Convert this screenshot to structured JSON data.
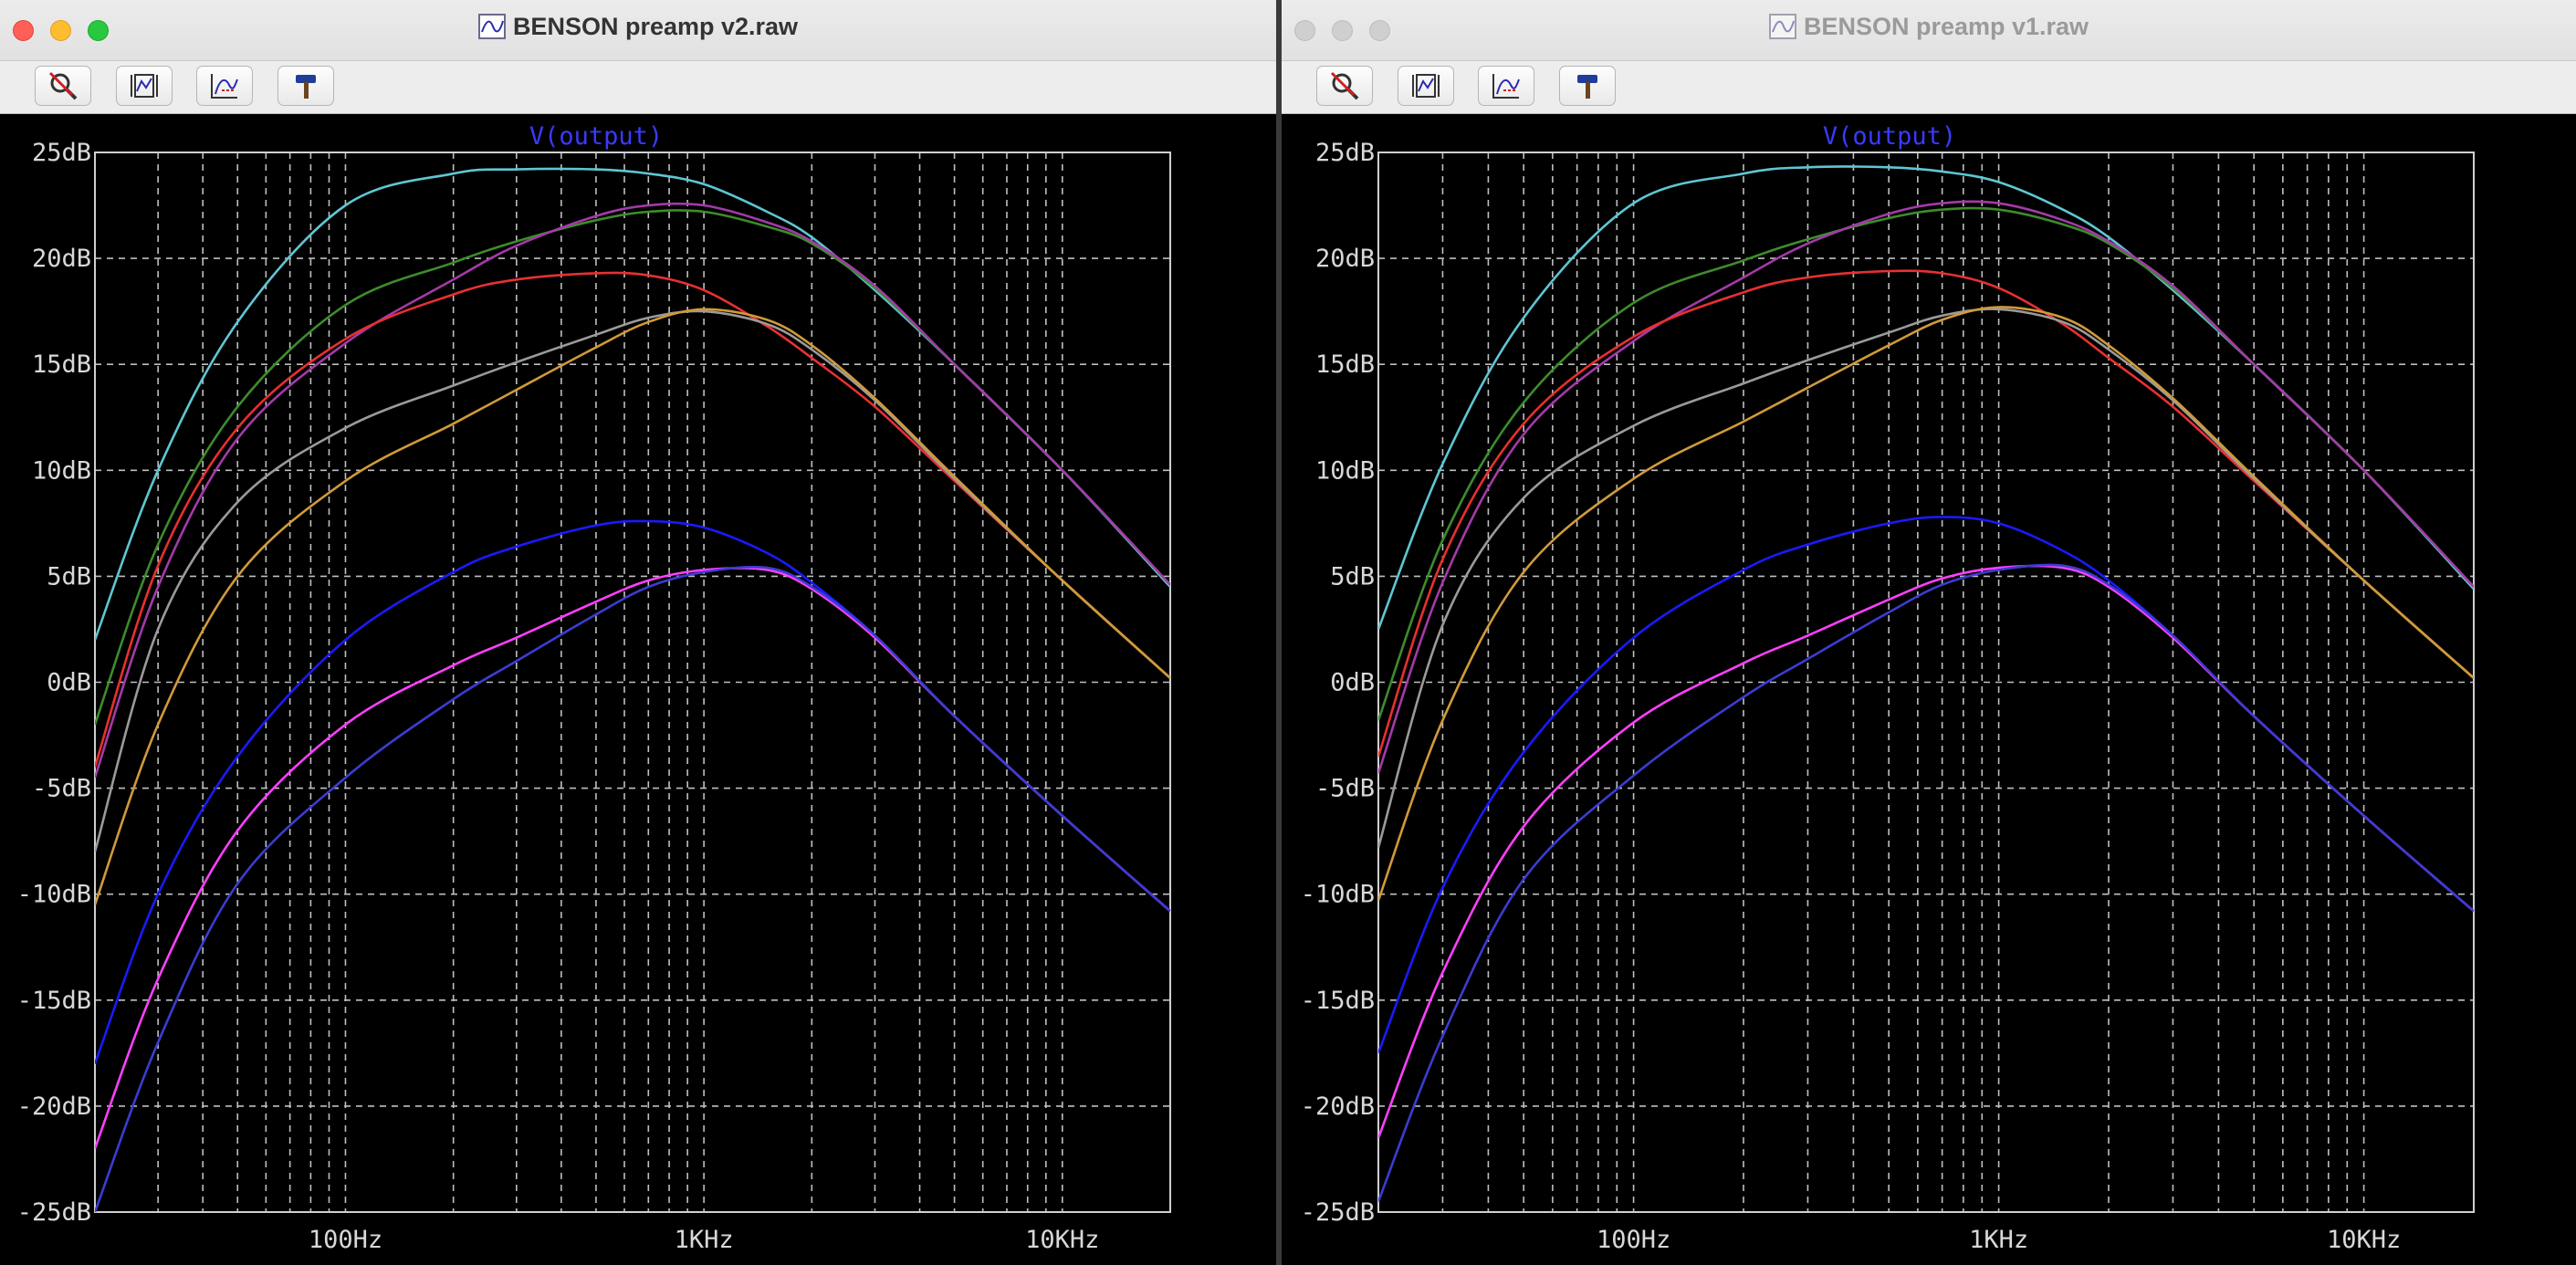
{
  "windows": [
    {
      "id": "v2",
      "title": "BENSON preamp v2.raw",
      "active": true,
      "toolbar": [
        "zoom-cancel-icon",
        "autorange-icon",
        "pan-icon",
        "hammer-icon"
      ],
      "trace_title": "V(output)"
    },
    {
      "id": "v1",
      "title": "BENSON preamp v1.raw",
      "active": false,
      "toolbar": [
        "zoom-cancel-icon",
        "autorange-icon",
        "pan-icon",
        "hammer-icon"
      ],
      "trace_title": "V(output)"
    }
  ],
  "chart_data": [
    {
      "type": "line",
      "title": "V(output)",
      "xscale": "log",
      "xlim_hz": [
        20,
        20000
      ],
      "ylim_db": [
        -25,
        25
      ],
      "grid": true,
      "x_ticks": [
        {
          "hz": 100,
          "label": "100Hz"
        },
        {
          "hz": 1000,
          "label": "1KHz"
        },
        {
          "hz": 10000,
          "label": "10KHz"
        }
      ],
      "y_ticks": [
        "25dB",
        "20dB",
        "15dB",
        "10dB",
        "5dB",
        "0dB",
        "-5dB",
        "-10dB",
        "-15dB",
        "-20dB",
        "-25dB"
      ],
      "freq_hz": [
        20,
        30,
        50,
        100,
        200,
        300,
        500,
        700,
        1000,
        1500,
        2000,
        3000,
        5000,
        10000,
        20000
      ],
      "series": [
        {
          "color": "#5fc6d2",
          "values": [
            2.0,
            10.0,
            17.0,
            22.5,
            24.0,
            24.2,
            24.2,
            24.0,
            23.5,
            22.2,
            21.0,
            18.5,
            15.0,
            10.0,
            4.5
          ]
        },
        {
          "color": "#3d8c2c",
          "values": [
            -2.0,
            6.5,
            13.0,
            17.8,
            19.8,
            20.8,
            21.8,
            22.2,
            22.2,
            21.5,
            20.7,
            18.6,
            15.0,
            10.0,
            4.6
          ]
        },
        {
          "color": "#a33aa8",
          "values": [
            -4.5,
            4.5,
            11.5,
            16.0,
            19.0,
            20.6,
            22.0,
            22.5,
            22.5,
            21.7,
            20.8,
            18.7,
            15.0,
            10.0,
            4.6
          ]
        },
        {
          "color": "#e83030",
          "values": [
            -4.0,
            5.5,
            12.0,
            16.2,
            18.3,
            19.0,
            19.3,
            19.2,
            18.5,
            16.8,
            15.3,
            13.0,
            9.5,
            4.8,
            0.2
          ]
        },
        {
          "color": "#9a9a9a",
          "values": [
            -8.0,
            2.5,
            8.5,
            12.0,
            14.0,
            15.1,
            16.4,
            17.2,
            17.5,
            16.9,
            15.7,
            13.3,
            9.6,
            4.8,
            0.2
          ]
        },
        {
          "color": "#d09a3a",
          "values": [
            -10.5,
            -2.0,
            5.0,
            9.5,
            12.2,
            13.8,
            15.8,
            17.0,
            17.6,
            17.1,
            15.9,
            13.4,
            9.7,
            4.8,
            0.2
          ]
        },
        {
          "color": "#1a1aff",
          "values": [
            -18.0,
            -10.0,
            -3.5,
            2.0,
            5.2,
            6.4,
            7.4,
            7.6,
            7.3,
            6.1,
            4.7,
            2.2,
            -1.6,
            -6.3,
            -10.8
          ]
        },
        {
          "color": "#ff40ff",
          "values": [
            -22.0,
            -14.0,
            -7.0,
            -2.0,
            0.8,
            2.1,
            3.8,
            4.8,
            5.3,
            5.3,
            4.4,
            2.1,
            -1.6,
            -6.3,
            -10.8
          ]
        },
        {
          "color": "#3c3cd2",
          "values": [
            -25.0,
            -17.0,
            -9.5,
            -4.5,
            -0.8,
            1.0,
            3.2,
            4.5,
            5.2,
            5.4,
            4.5,
            2.2,
            -1.6,
            -6.3,
            -10.8
          ]
        }
      ]
    },
    {
      "type": "line",
      "title": "V(output)",
      "xscale": "log",
      "xlim_hz": [
        20,
        20000
      ],
      "ylim_db": [
        -25,
        25
      ],
      "grid": true,
      "x_ticks": [
        {
          "hz": 100,
          "label": "100Hz"
        },
        {
          "hz": 1000,
          "label": "1KHz"
        },
        {
          "hz": 10000,
          "label": "10KHz"
        }
      ],
      "y_ticks": [
        "25dB",
        "20dB",
        "15dB",
        "10dB",
        "5dB",
        "0dB",
        "-5dB",
        "-10dB",
        "-15dB",
        "-20dB",
        "-25dB"
      ],
      "freq_hz": [
        20,
        30,
        50,
        100,
        200,
        300,
        500,
        700,
        1000,
        1500,
        2000,
        3000,
        5000,
        10000,
        20000
      ],
      "series": [
        {
          "color": "#5fc6d2",
          "values": [
            2.5,
            10.3,
            17.2,
            22.6,
            24.0,
            24.3,
            24.3,
            24.1,
            23.6,
            22.3,
            21.0,
            18.5,
            15.0,
            10.0,
            4.4
          ]
        },
        {
          "color": "#3d8c2c",
          "values": [
            -1.8,
            6.7,
            13.2,
            17.9,
            19.9,
            20.9,
            21.9,
            22.3,
            22.3,
            21.6,
            20.7,
            18.6,
            15.0,
            10.0,
            4.5
          ]
        },
        {
          "color": "#a33aa8",
          "values": [
            -4.3,
            4.7,
            11.7,
            16.1,
            19.1,
            20.7,
            22.1,
            22.6,
            22.6,
            21.8,
            20.8,
            18.7,
            15.0,
            10.0,
            4.5
          ]
        },
        {
          "color": "#e83030",
          "values": [
            -3.5,
            5.8,
            12.2,
            16.3,
            18.4,
            19.1,
            19.4,
            19.3,
            18.6,
            16.9,
            15.3,
            13.0,
            9.5,
            4.8,
            0.2
          ]
        },
        {
          "color": "#9a9a9a",
          "values": [
            -7.8,
            2.7,
            8.7,
            12.1,
            14.1,
            15.2,
            16.5,
            17.3,
            17.6,
            17.0,
            15.7,
            13.3,
            9.6,
            4.8,
            0.2
          ]
        },
        {
          "color": "#d09a3a",
          "values": [
            -10.3,
            -1.8,
            5.2,
            9.6,
            12.3,
            13.9,
            15.9,
            17.1,
            17.7,
            17.2,
            15.9,
            13.4,
            9.7,
            4.8,
            0.2
          ]
        },
        {
          "color": "#1a1aff",
          "values": [
            -17.5,
            -9.7,
            -3.3,
            2.1,
            5.3,
            6.5,
            7.5,
            7.8,
            7.5,
            6.2,
            4.8,
            2.2,
            -1.6,
            -6.3,
            -10.8
          ]
        },
        {
          "color": "#ff40ff",
          "values": [
            -21.5,
            -13.7,
            -6.8,
            -1.9,
            0.9,
            2.2,
            3.9,
            4.9,
            5.4,
            5.4,
            4.5,
            2.1,
            -1.6,
            -6.3,
            -10.8
          ]
        },
        {
          "color": "#3c3cd2",
          "values": [
            -24.5,
            -16.7,
            -9.3,
            -4.4,
            -0.7,
            1.1,
            3.3,
            4.6,
            5.3,
            5.5,
            4.6,
            2.2,
            -1.6,
            -6.3,
            -10.8
          ]
        }
      ]
    }
  ]
}
